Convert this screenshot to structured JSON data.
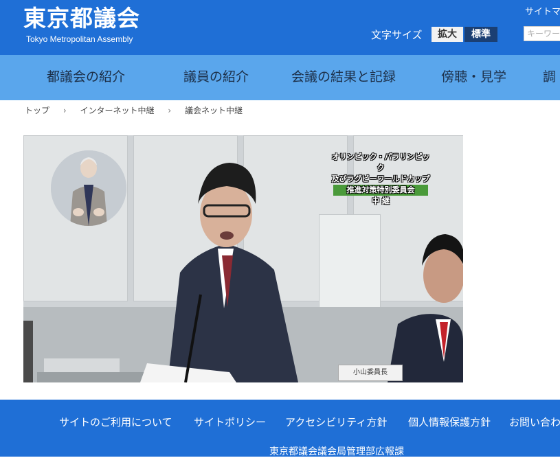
{
  "header": {
    "logo_ja": "東京都議会",
    "logo_en": "Tokyo Metropolitan Assembly",
    "font_size_label": "文字サイズ",
    "font_size_large": "拡大",
    "font_size_standard": "標準",
    "sitemap": "サイトマ",
    "search_placeholder": "キーワー"
  },
  "nav": {
    "items": [
      {
        "label": "都議会の紹介"
      },
      {
        "label": "議員の紹介"
      },
      {
        "label": "会議の結果と記録"
      },
      {
        "label": "傍聴・見学"
      },
      {
        "label": "調"
      }
    ]
  },
  "breadcrumb": {
    "items": [
      "トップ",
      "インターネット中継",
      "議会ネット中継"
    ],
    "separator": "›"
  },
  "video": {
    "caption_lines": [
      "オリンピック・パラリンピック",
      "及びラグビーワールドカップ",
      "推進対策特別委員会",
      "中 継"
    ],
    "nameplate": "小山委員長"
  },
  "footer": {
    "links": [
      {
        "label": "サイトのご利用について"
      },
      {
        "label": "サイトポリシー"
      },
      {
        "label": "アクセシビリティ方針"
      },
      {
        "label": "個人情報保護方針"
      },
      {
        "label": "お問い合わ"
      }
    ],
    "org": "東京都議会議会局管理部広報課"
  },
  "colors": {
    "header_bg": "#1f6fd6",
    "nav_bg": "#5aa6ec",
    "footer_bg": "#1f6fd6"
  }
}
